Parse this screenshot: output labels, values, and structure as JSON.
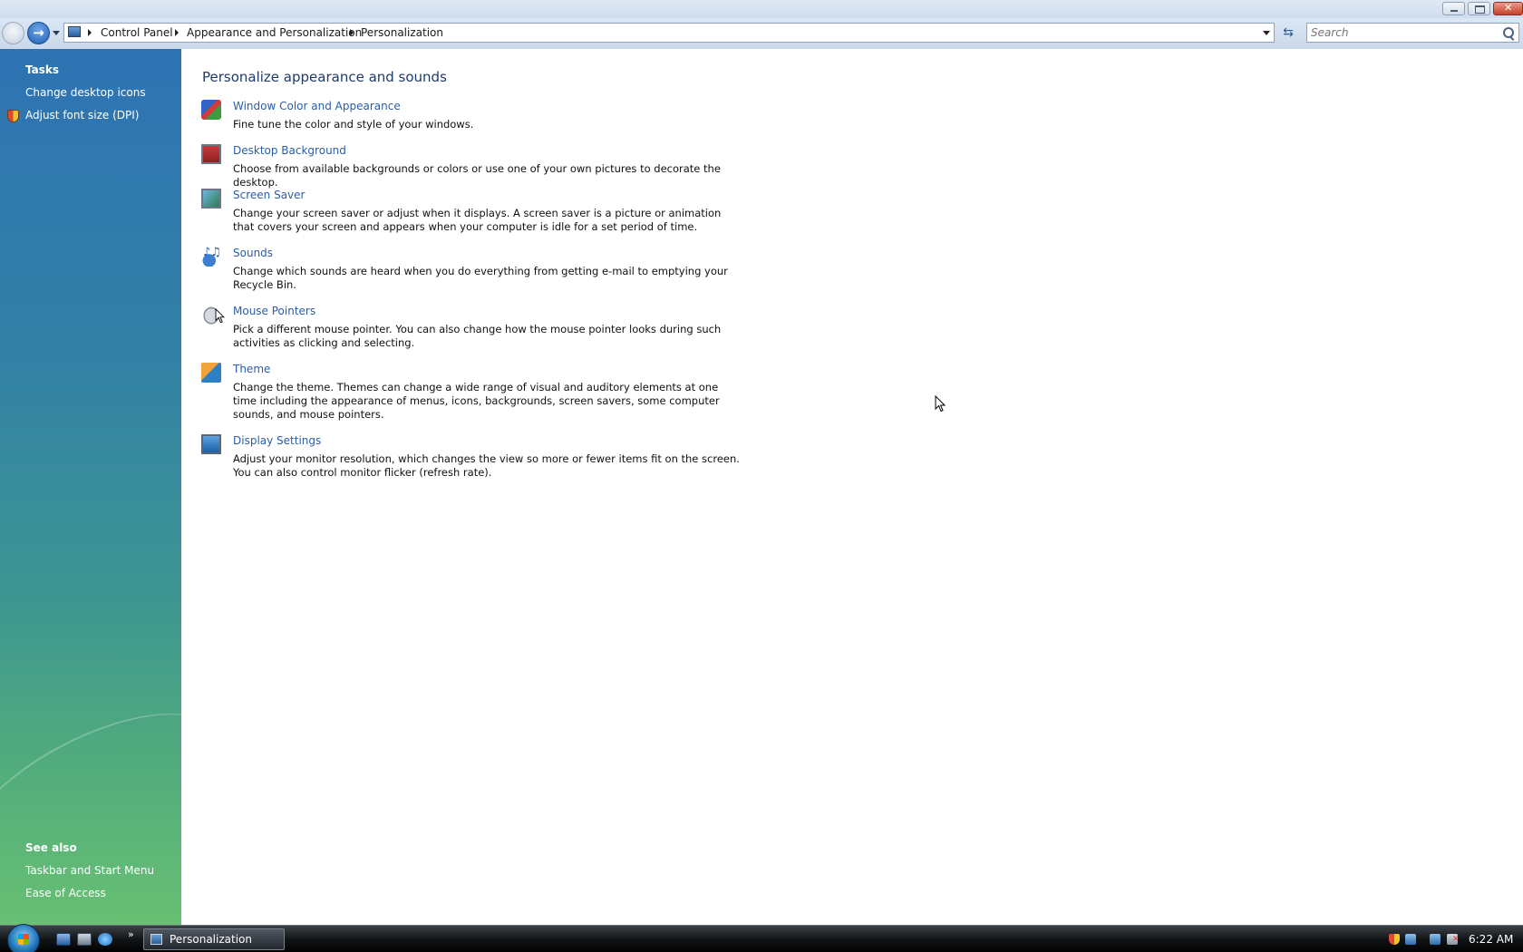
{
  "window": {
    "controls": {
      "minimize": "minimize",
      "maximize": "maximize",
      "close": "close"
    }
  },
  "address": {
    "breadcrumbs": [
      "Control Panel",
      "Appearance and Personalization",
      "Personalization"
    ],
    "search_placeholder": "Search"
  },
  "taskpane": {
    "tasks_heading": "Tasks",
    "tasks": [
      {
        "label": "Change desktop icons",
        "icon": "none"
      },
      {
        "label": "Adjust font size (DPI)",
        "icon": "uac-shield-icon"
      }
    ],
    "see_also_heading": "See also",
    "see_also": [
      "Taskbar and Start Menu",
      "Ease of Access"
    ]
  },
  "main": {
    "title": "Personalize appearance and sounds",
    "items": [
      {
        "link": "Window Color and Appearance",
        "desc": "Fine tune the color and style of your windows.",
        "icon": "window-color-icon"
      },
      {
        "link": "Desktop Background",
        "desc": "Choose from available backgrounds or colors or use one of your own pictures to decorate the desktop.",
        "icon": "desktop-background-icon"
      },
      {
        "link": "Screen Saver",
        "desc": "Change your screen saver or adjust when it displays. A screen saver is a picture or animation that covers your screen and appears when your computer is idle for a set period of time.",
        "icon": "screen-saver-icon"
      },
      {
        "link": "Sounds",
        "desc": "Change which sounds are heard when you do everything from getting e-mail to emptying your Recycle Bin.",
        "icon": "sounds-icon"
      },
      {
        "link": "Mouse Pointers",
        "desc": "Pick a different mouse pointer. You can also change how the mouse pointer looks during such activities as clicking and selecting.",
        "icon": "mouse-pointers-icon"
      },
      {
        "link": "Theme",
        "desc": "Change the theme. Themes can change a wide range of visual and auditory elements at one time including the appearance of menus, icons, backgrounds, screen savers, some computer sounds, and mouse pointers.",
        "icon": "theme-icon"
      },
      {
        "link": "Display Settings",
        "desc": "Adjust your monitor resolution, which changes the view so more or fewer items fit on the screen. You can also control monitor flicker (refresh rate).",
        "icon": "display-settings-icon"
      }
    ]
  },
  "taskbar": {
    "task_label": "Personalization",
    "more_glyph": "»",
    "clock": "6:22 AM"
  },
  "colors": {
    "link": "#2a5da8",
    "title": "#1e3b6e",
    "pane_top": "#2e73b3",
    "pane_bottom": "#68c073"
  }
}
